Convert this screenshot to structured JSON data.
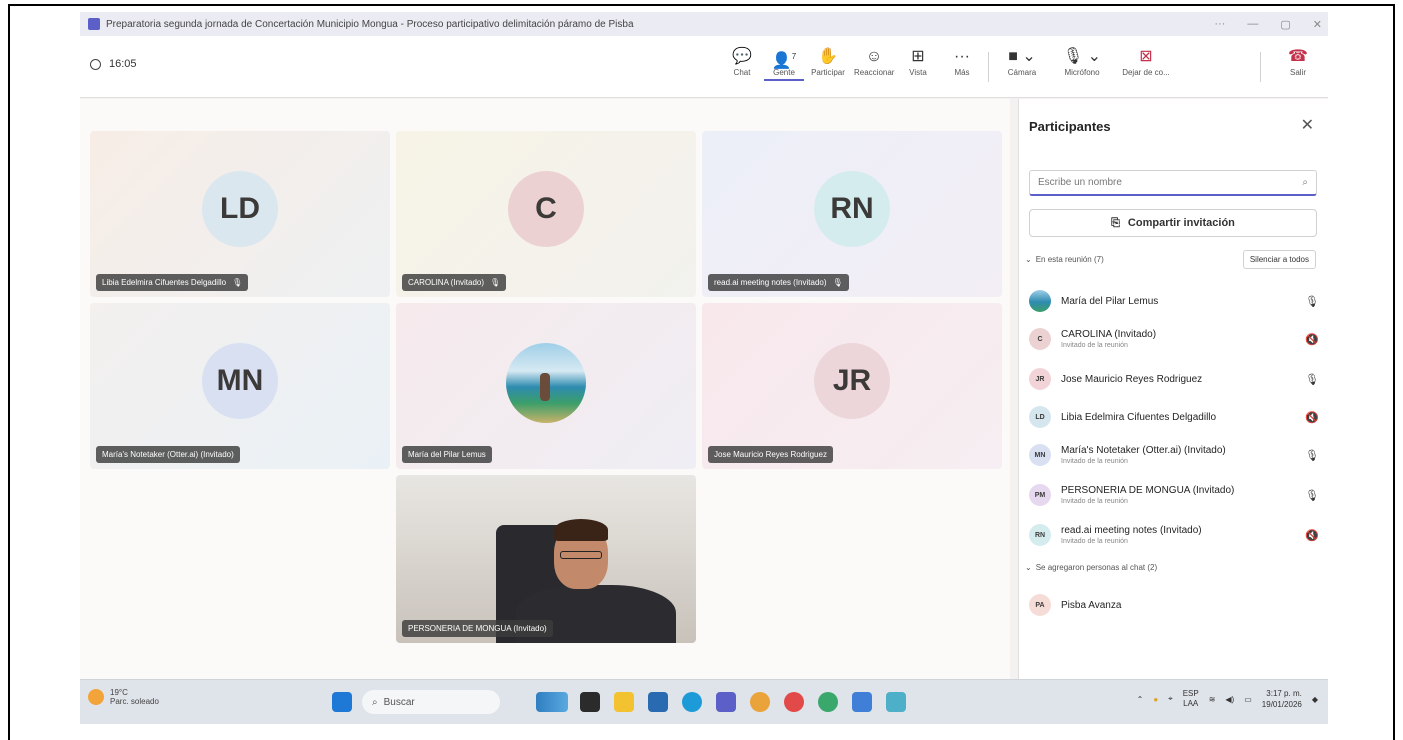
{
  "window": {
    "title": "Preparatoria segunda jornada de Concertación Municipio Mongua - Proceso participativo delimitación páramo de Pisba",
    "controls": [
      "···",
      "—",
      "▢",
      "✕"
    ]
  },
  "toolbar": {
    "timer": "16:05",
    "buttons": [
      {
        "label": "Chat",
        "icon": "chat-icon"
      },
      {
        "label": "Gente",
        "icon": "people-icon",
        "count": "7"
      },
      {
        "label": "Participar",
        "icon": "raise-hand-icon"
      },
      {
        "label": "Reaccionar",
        "icon": "react-icon"
      },
      {
        "label": "Vista",
        "icon": "view-icon"
      },
      {
        "label": "Más",
        "icon": "more-icon"
      },
      {
        "label": "Cámara",
        "icon": "camera-off-icon"
      },
      {
        "label": "Micrófono",
        "icon": "mic-icon"
      },
      {
        "label": "Dejar de co...",
        "icon": "stop-share-icon"
      },
      {
        "label": "Salir",
        "icon": "leave-icon"
      }
    ]
  },
  "stage": {
    "tiles": [
      {
        "initials": "LD",
        "name": "Libia Edelmira Cifuentes Delgadillo",
        "muted": true
      },
      {
        "initials": "C",
        "name": "CAROLINA (Invitado)",
        "muted": true
      },
      {
        "initials": "RN",
        "name": "read.ai meeting notes (Invitado)",
        "muted": true
      },
      {
        "initials": "MN",
        "name": "María's Notetaker (Otter.ai) (Invitado)",
        "muted": false
      },
      {
        "initials": "",
        "name": "María del Pilar Lemus",
        "muted": false
      },
      {
        "initials": "JR",
        "name": "Jose Mauricio Reyes Rodriguez",
        "muted": false
      },
      {
        "initials": "",
        "name": "PERSONERIA DE MONGUA (Invitado)",
        "muted": false
      }
    ]
  },
  "panel": {
    "title": "Participantes",
    "search_placeholder": "Escribe un nombre",
    "invite_label": "Compartir invitación",
    "in_meeting_label": "En esta reunión (7)",
    "mute_all_label": "Silenciar a todos",
    "added_chat_label": "Se agregaron personas al chat (2)",
    "participants": [
      {
        "initials": "",
        "name": "María del Pilar Lemus",
        "sub": "",
        "mic": "on"
      },
      {
        "initials": "C",
        "name": "CAROLINA (Invitado)",
        "sub": "Invitado de la reunión",
        "mic": "off"
      },
      {
        "initials": "JR",
        "name": "Jose Mauricio Reyes Rodriguez",
        "sub": "",
        "mic": "on"
      },
      {
        "initials": "LD",
        "name": "Libia Edelmira Cifuentes Delgadillo",
        "sub": "",
        "mic": "off"
      },
      {
        "initials": "MN",
        "name": "María's Notetaker (Otter.ai) (Invitado)",
        "sub": "Invitado de la reunión",
        "mic": "on"
      },
      {
        "initials": "PM",
        "name": "PERSONERIA DE MONGUA (Invitado)",
        "sub": "Invitado de la reunión",
        "mic": "on"
      },
      {
        "initials": "RN",
        "name": "read.ai meeting notes (Invitado)",
        "sub": "Invitado de la reunión",
        "mic": "off"
      }
    ],
    "chat_people": [
      {
        "initials": "PA",
        "name": "Pisba Avanza"
      }
    ]
  },
  "taskbar": {
    "weather_temp": "19°C",
    "weather_desc": "Parc. soleado",
    "search_label": "Buscar",
    "lang_top": "ESP",
    "lang_bottom": "LAA",
    "time": "3:17 p. m.",
    "date": "19/01/2026"
  },
  "colors": {
    "accent": "#5b5fc7",
    "leave": "#c4314b"
  }
}
